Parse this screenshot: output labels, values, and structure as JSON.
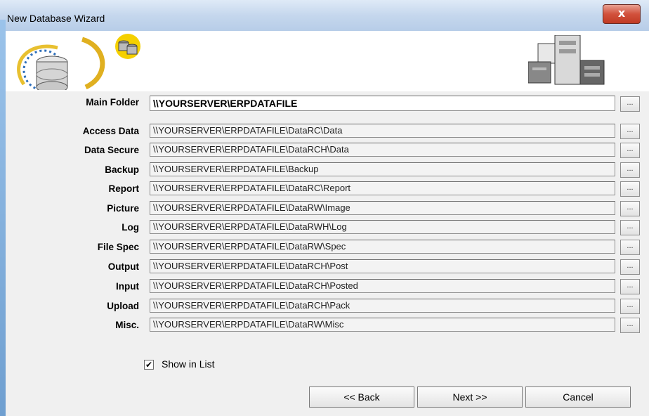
{
  "window": {
    "title": "New Database Wizard",
    "close_label": "x"
  },
  "form": {
    "main_folder_label": "Main Folder",
    "main_folder_value": "\\\\YOURSERVER\\ERPDATAFILE",
    "browse_label": "...",
    "rows": [
      {
        "label": "Access Data",
        "value": "\\\\YOURSERVER\\ERPDATAFILE\\DataRC\\Data"
      },
      {
        "label": "Data Secure",
        "value": "\\\\YOURSERVER\\ERPDATAFILE\\DataRCH\\Data"
      },
      {
        "label": "Backup",
        "value": "\\\\YOURSERVER\\ERPDATAFILE\\Backup"
      },
      {
        "label": "Report",
        "value": "\\\\YOURSERVER\\ERPDATAFILE\\DataRC\\Report"
      },
      {
        "label": "Picture",
        "value": "\\\\YOURSERVER\\ERPDATAFILE\\DataRW\\Image"
      },
      {
        "label": "Log",
        "value": "\\\\YOURSERVER\\ERPDATAFILE\\DataRWH\\Log"
      },
      {
        "label": "File Spec",
        "value": "\\\\YOURSERVER\\ERPDATAFILE\\DataRW\\Spec"
      },
      {
        "label": "Output",
        "value": "\\\\YOURSERVER\\ERPDATAFILE\\DataRCH\\Post"
      },
      {
        "label": "Input",
        "value": "\\\\YOURSERVER\\ERPDATAFILE\\DataRCH\\Posted"
      },
      {
        "label": "Upload",
        "value": "\\\\YOURSERVER\\ERPDATAFILE\\DataRCH\\Pack"
      },
      {
        "label": "Misc.",
        "value": "\\\\YOURSERVER\\ERPDATAFILE\\DataRW\\Misc"
      }
    ]
  },
  "options": {
    "show_in_list_label": "Show in List",
    "show_in_list_checked": true,
    "check_mark": "✔"
  },
  "buttons": {
    "back": "<< Back",
    "next": "Next >>",
    "cancel": "Cancel"
  },
  "icons": {
    "header_left": "database-wizard-icon",
    "header_right": "server-icon"
  }
}
